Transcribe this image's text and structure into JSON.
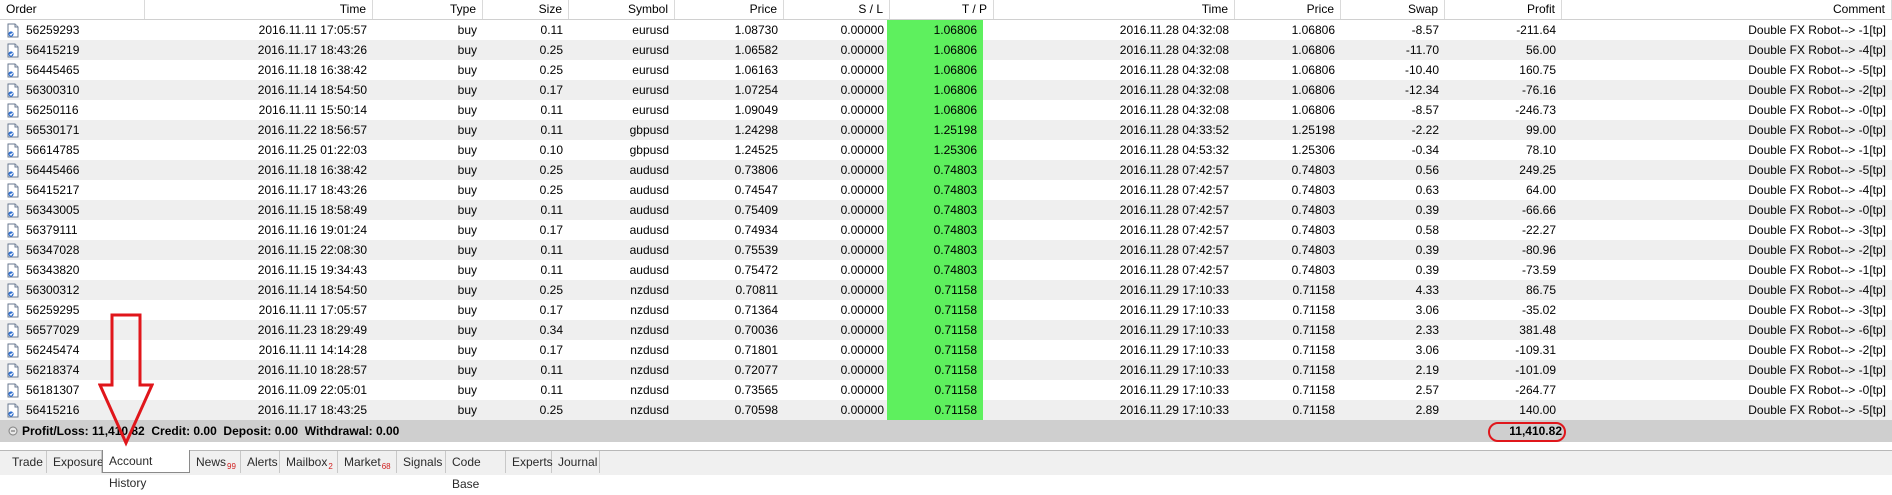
{
  "headers": {
    "order": "Order",
    "time": "Time",
    "type": "Type",
    "size": "Size",
    "symbol": "Symbol",
    "price": "Price",
    "sl": "S / L",
    "tp": "T / P",
    "close_time": "Time",
    "close_price": "Price",
    "swap": "Swap",
    "profit": "Profit",
    "comment": "Comment"
  },
  "rows": [
    [
      "56259293",
      "2016.11.11 17:05:57",
      "buy",
      "0.11",
      "eurusd",
      "1.08730",
      "0.00000",
      "1.06806",
      "2016.11.28 04:32:08",
      "1.06806",
      "-8.57",
      "-211.64",
      "Double FX Robot--> -1[tp]"
    ],
    [
      "56415219",
      "2016.11.17 18:43:26",
      "buy",
      "0.25",
      "eurusd",
      "1.06582",
      "0.00000",
      "1.06806",
      "2016.11.28 04:32:08",
      "1.06806",
      "-11.70",
      "56.00",
      "Double FX Robot--> -4[tp]"
    ],
    [
      "56445465",
      "2016.11.18 16:38:42",
      "buy",
      "0.25",
      "eurusd",
      "1.06163",
      "0.00000",
      "1.06806",
      "2016.11.28 04:32:08",
      "1.06806",
      "-10.40",
      "160.75",
      "Double FX Robot--> -5[tp]"
    ],
    [
      "56300310",
      "2016.11.14 18:54:50",
      "buy",
      "0.17",
      "eurusd",
      "1.07254",
      "0.00000",
      "1.06806",
      "2016.11.28 04:32:08",
      "1.06806",
      "-12.34",
      "-76.16",
      "Double FX Robot--> -2[tp]"
    ],
    [
      "56250116",
      "2016.11.11 15:50:14",
      "buy",
      "0.11",
      "eurusd",
      "1.09049",
      "0.00000",
      "1.06806",
      "2016.11.28 04:32:08",
      "1.06806",
      "-8.57",
      "-246.73",
      "Double FX Robot--> -0[tp]"
    ],
    [
      "56530171",
      "2016.11.22 18:56:57",
      "buy",
      "0.11",
      "gbpusd",
      "1.24298",
      "0.00000",
      "1.25198",
      "2016.11.28 04:33:52",
      "1.25198",
      "-2.22",
      "99.00",
      "Double FX Robot--> -0[tp]"
    ],
    [
      "56614785",
      "2016.11.25 01:22:03",
      "buy",
      "0.10",
      "gbpusd",
      "1.24525",
      "0.00000",
      "1.25306",
      "2016.11.28 04:53:32",
      "1.25306",
      "-0.34",
      "78.10",
      "Double FX Robot--> -1[tp]"
    ],
    [
      "56445466",
      "2016.11.18 16:38:42",
      "buy",
      "0.25",
      "audusd",
      "0.73806",
      "0.00000",
      "0.74803",
      "2016.11.28 07:42:57",
      "0.74803",
      "0.56",
      "249.25",
      "Double FX Robot--> -5[tp]"
    ],
    [
      "56415217",
      "2016.11.17 18:43:26",
      "buy",
      "0.25",
      "audusd",
      "0.74547",
      "0.00000",
      "0.74803",
      "2016.11.28 07:42:57",
      "0.74803",
      "0.63",
      "64.00",
      "Double FX Robot--> -4[tp]"
    ],
    [
      "56343005",
      "2016.11.15 18:58:49",
      "buy",
      "0.11",
      "audusd",
      "0.75409",
      "0.00000",
      "0.74803",
      "2016.11.28 07:42:57",
      "0.74803",
      "0.39",
      "-66.66",
      "Double FX Robot--> -0[tp]"
    ],
    [
      "56379111",
      "2016.11.16 19:01:24",
      "buy",
      "0.17",
      "audusd",
      "0.74934",
      "0.00000",
      "0.74803",
      "2016.11.28 07:42:57",
      "0.74803",
      "0.58",
      "-22.27",
      "Double FX Robot--> -3[tp]"
    ],
    [
      "56347028",
      "2016.11.15 22:08:30",
      "buy",
      "0.11",
      "audusd",
      "0.75539",
      "0.00000",
      "0.74803",
      "2016.11.28 07:42:57",
      "0.74803",
      "0.39",
      "-80.96",
      "Double FX Robot--> -2[tp]"
    ],
    [
      "56343820",
      "2016.11.15 19:34:43",
      "buy",
      "0.11",
      "audusd",
      "0.75472",
      "0.00000",
      "0.74803",
      "2016.11.28 07:42:57",
      "0.74803",
      "0.39",
      "-73.59",
      "Double FX Robot--> -1[tp]"
    ],
    [
      "56300312",
      "2016.11.14 18:54:50",
      "buy",
      "0.25",
      "nzdusd",
      "0.70811",
      "0.00000",
      "0.71158",
      "2016.11.29 17:10:33",
      "0.71158",
      "4.33",
      "86.75",
      "Double FX Robot--> -4[tp]"
    ],
    [
      "56259295",
      "2016.11.11 17:05:57",
      "buy",
      "0.17",
      "nzdusd",
      "0.71364",
      "0.00000",
      "0.71158",
      "2016.11.29 17:10:33",
      "0.71158",
      "3.06",
      "-35.02",
      "Double FX Robot--> -3[tp]"
    ],
    [
      "56577029",
      "2016.11.23 18:29:49",
      "buy",
      "0.34",
      "nzdusd",
      "0.70036",
      "0.00000",
      "0.71158",
      "2016.11.29 17:10:33",
      "0.71158",
      "2.33",
      "381.48",
      "Double FX Robot--> -6[tp]"
    ],
    [
      "56245474",
      "2016.11.11 14:14:28",
      "buy",
      "0.17",
      "nzdusd",
      "0.71801",
      "0.00000",
      "0.71158",
      "2016.11.29 17:10:33",
      "0.71158",
      "3.06",
      "-109.31",
      "Double FX Robot--> -2[tp]"
    ],
    [
      "56218374",
      "2016.11.10 18:28:57",
      "buy",
      "0.11",
      "nzdusd",
      "0.72077",
      "0.00000",
      "0.71158",
      "2016.11.29 17:10:33",
      "0.71158",
      "2.19",
      "-101.09",
      "Double FX Robot--> -1[tp]"
    ],
    [
      "56181307",
      "2016.11.09 22:05:01",
      "buy",
      "0.11",
      "nzdusd",
      "0.73565",
      "0.00000",
      "0.71158",
      "2016.11.29 17:10:33",
      "0.71158",
      "2.57",
      "-264.77",
      "Double FX Robot--> -0[tp]"
    ],
    [
      "56415216",
      "2016.11.17 18:43:25",
      "buy",
      "0.25",
      "nzdusd",
      "0.70598",
      "0.00000",
      "0.71158",
      "2016.11.29 17:10:33",
      "0.71158",
      "2.89",
      "140.00",
      "Double FX Robot--> -5[tp]"
    ]
  ],
  "summary": {
    "text": "Profit/Loss: 11,410.82  Credit: 0.00  Deposit: 0.00  Withdrawal: 0.00",
    "profit_total": "11,410.82"
  },
  "tabs": [
    {
      "label": "Trade",
      "badge": ""
    },
    {
      "label": "Exposure",
      "badge": ""
    },
    {
      "label": "Account History",
      "badge": ""
    },
    {
      "label": "News",
      "badge": "99"
    },
    {
      "label": "Alerts",
      "badge": ""
    },
    {
      "label": "Mailbox",
      "badge": "2"
    },
    {
      "label": "Market",
      "badge": "68"
    },
    {
      "label": "Signals",
      "badge": ""
    },
    {
      "label": "Code Base",
      "badge": ""
    },
    {
      "label": "Experts",
      "badge": ""
    },
    {
      "label": "Journal",
      "badge": ""
    }
  ],
  "active_tab": "Account History",
  "colors": {
    "tp_highlight": "#5ef05e",
    "annotation_red": "#e0161b",
    "row_alt": "#efefef"
  }
}
